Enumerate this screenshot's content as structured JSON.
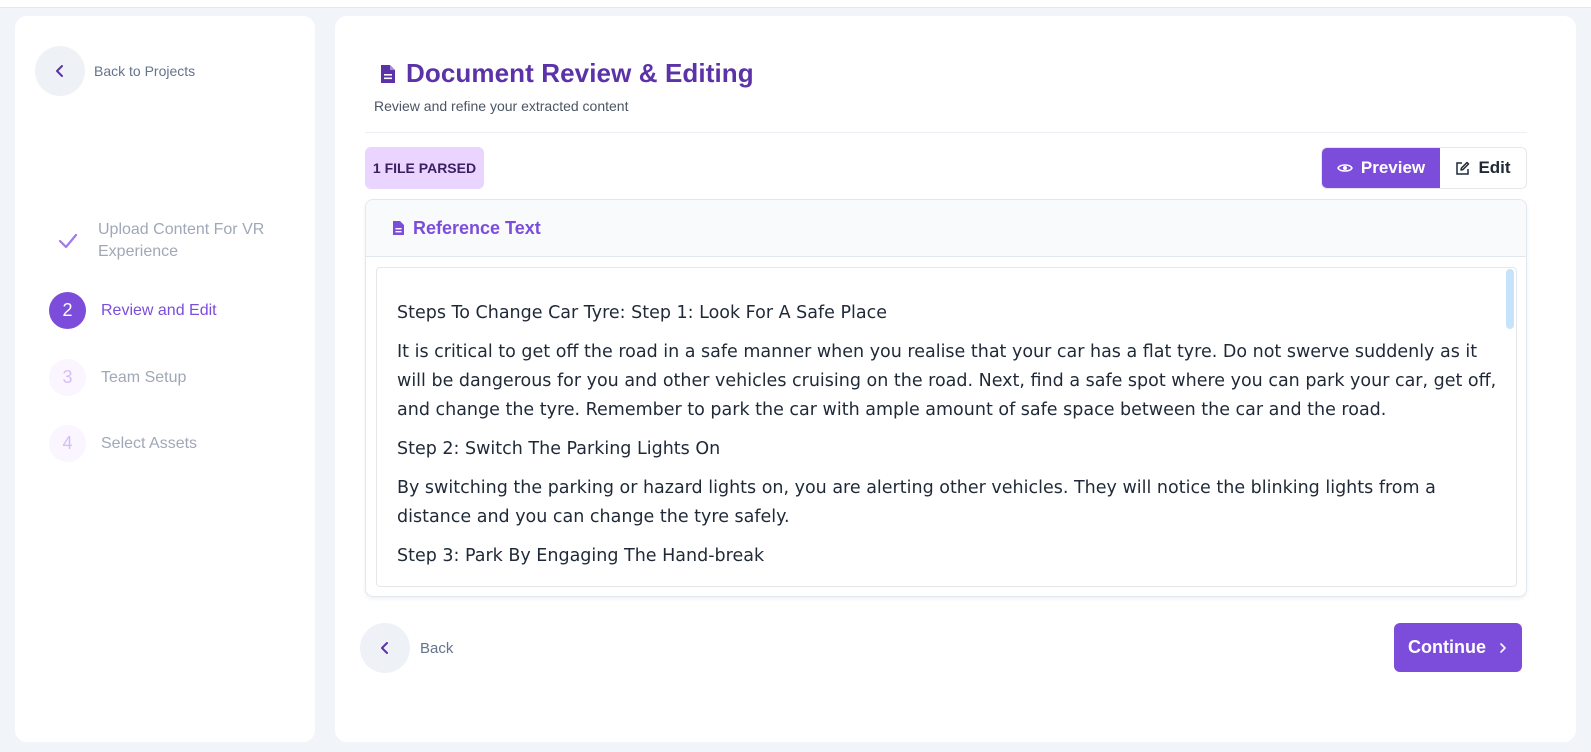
{
  "sidebar": {
    "back_label": "Back to Projects",
    "steps": [
      {
        "num": "",
        "label": "Upload Content For VR Experience",
        "state": "done"
      },
      {
        "num": "2",
        "label": "Review and Edit",
        "state": "active"
      },
      {
        "num": "3",
        "label": "Team Setup",
        "state": "future"
      },
      {
        "num": "4",
        "label": "Select Assets",
        "state": "future"
      }
    ]
  },
  "header": {
    "title": "Document Review & Editing",
    "subtitle": "Review and refine your extracted content"
  },
  "badge": "1 FILE PARSED",
  "view_toggle": {
    "preview_label": "Preview",
    "edit_label": "Edit",
    "selected": "Preview"
  },
  "reference": {
    "title": "Reference Text",
    "paragraphs": [
      "Steps To Change Car Tyre: Step 1: Look For A Safe Place",
      "It is critical to get off the road in a safe manner when you realise that your car has a flat tyre. Do not swerve suddenly as it will be dangerous for you and other vehicles cruising on the road. Next, find a safe spot where you can park your car, get off, and change the tyre. Remember to park the car with ample amount of safe space between the car and the road.",
      "Step 2: Switch The Parking Lights On",
      "By switching the parking or hazard lights on, you are alerting other vehicles. They will notice the blinking lights from a distance and you can change the tyre safely.",
      "Step 3: Park By Engaging The Hand-break"
    ]
  },
  "footer": {
    "back_label": "Back",
    "continue_label": "Continue"
  },
  "colors": {
    "accent": "#7c4ddb",
    "title": "#5b32a8",
    "badge_bg": "#e9d5ff"
  }
}
